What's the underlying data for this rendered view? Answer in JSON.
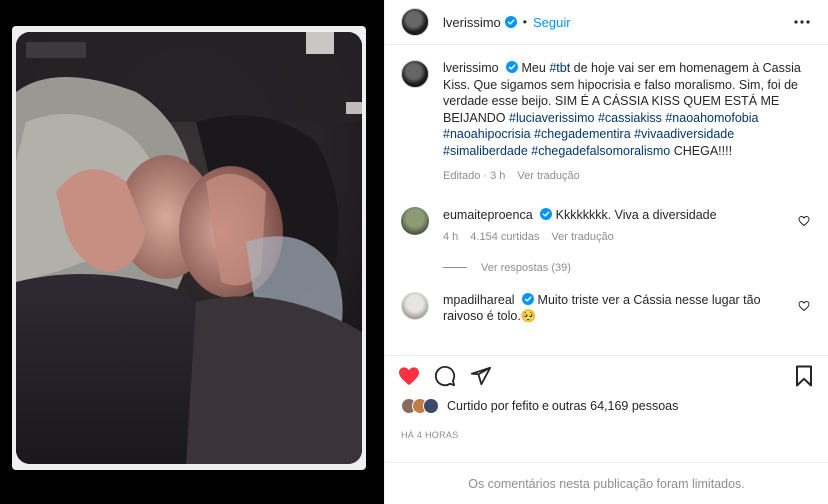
{
  "post": {
    "username": "lverissimo",
    "follow_label": "Seguir",
    "dot": "•"
  },
  "caption": {
    "username": "lverissimo",
    "parts": [
      {
        "text": " Meu ",
        "tag": false
      },
      {
        "text": "#tbt",
        "tag": true
      },
      {
        "text": " de hoje vai ser em homenagem à Cassia Kiss. Que sigamos sem hipocrisia e falso moralismo. Sim, foi de verdade esse beijo. SIM É A CÁSSIA KISS QUEM ESTÁ ME BEIJANDO ",
        "tag": false
      },
      {
        "text": "#luciaverissimo",
        "tag": true
      },
      {
        "text": " ",
        "tag": false
      },
      {
        "text": "#cassiakiss",
        "tag": true
      },
      {
        "text": " ",
        "tag": false
      },
      {
        "text": "#naoahomofobia",
        "tag": true
      },
      {
        "text": " ",
        "tag": false
      },
      {
        "text": "#naoahipocrisia",
        "tag": true
      },
      {
        "text": " ",
        "tag": false
      },
      {
        "text": "#chegadementira",
        "tag": true
      },
      {
        "text": " ",
        "tag": false
      },
      {
        "text": "#vivaadiversidade",
        "tag": true
      },
      {
        "text": " ",
        "tag": false
      },
      {
        "text": "#simaliberdade",
        "tag": true
      },
      {
        "text": " ",
        "tag": false
      },
      {
        "text": "#chegadefalsomoralismo",
        "tag": true
      },
      {
        "text": " CHEGA!!!!",
        "tag": false
      }
    ],
    "edited": "Editado · 3 h",
    "translate": "Ver tradução"
  },
  "comments": [
    {
      "username": "eumaiteproenca",
      "text": " Kkkkkkkk. Viva a diversidade",
      "time": "4 h",
      "likes": "4.154 curtidas",
      "translate": "Ver tradução",
      "avatar_color": "#6b7b5a"
    },
    {
      "username": "mpadilhareal",
      "text": " Muito triste ver a Cássia nesse lugar tão raivoso é tolo.🥺",
      "avatar_color": "#cfcfcf"
    }
  ],
  "replies": "Ver respostas (39)",
  "likes": {
    "prefix": "Curtido por ",
    "user": "fefito",
    "middle": " e ",
    "count": "outras 64,169 pessoas"
  },
  "time": "HÁ 4 HORAS",
  "limited": "Os comentários nesta publicação foram limitados.",
  "colors": {
    "accent": "#0095f6",
    "heart": "#ff3040",
    "verified": "#0095f6",
    "hashtag": "#00376b"
  },
  "icons": [
    "verified-badge-icon",
    "more-options-icon",
    "heart-icon",
    "comment-icon",
    "share-icon",
    "bookmark-icon",
    "small-heart-icon"
  ]
}
